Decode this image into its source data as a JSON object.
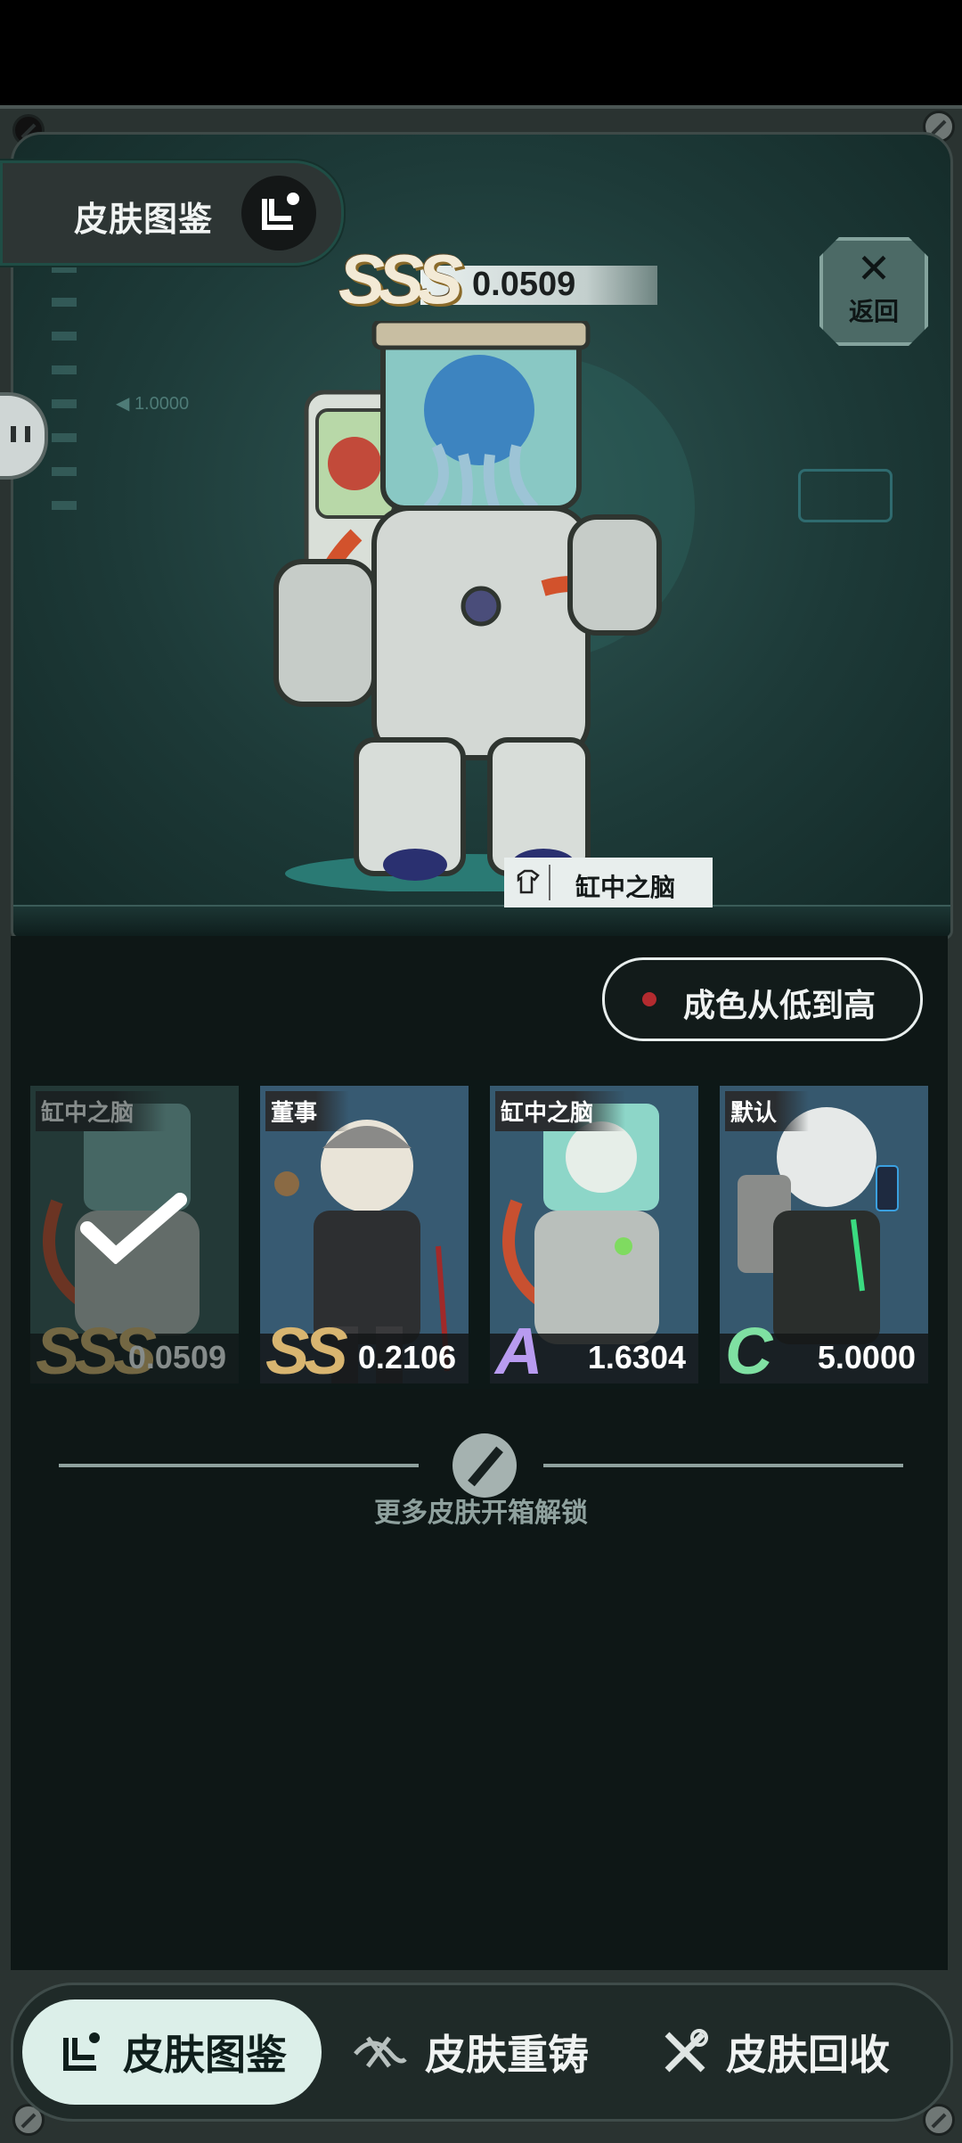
{
  "header": {
    "tab_title": "皮肤图鉴",
    "back_label": "返回",
    "back_icon": "close-x-icon",
    "grade": "SSS",
    "grade_value": "0.0509",
    "ruler_label": "1.0000"
  },
  "preview": {
    "skin_name": "缸中之脑",
    "skin_icon": "shirt-icon"
  },
  "sort": {
    "label": "成色从低到高",
    "dot_color": "#b32b2f"
  },
  "skins": [
    {
      "name": "缸中之脑",
      "grade": "SSS",
      "value": "0.0509",
      "selected": true,
      "grade_color": "#d8b570"
    },
    {
      "name": "董事",
      "grade": "SS",
      "value": "0.2106",
      "selected": false,
      "grade_color": "#d8b570"
    },
    {
      "name": "缸中之脑",
      "grade": "A",
      "value": "1.6304",
      "selected": false,
      "grade_color": "#b89bf0"
    },
    {
      "name": "默认",
      "grade": "C",
      "value": "5.0000",
      "selected": false,
      "grade_color": "#7fe0a2"
    }
  ],
  "unlock_hint": "更多皮肤开箱解锁",
  "bottom_nav": [
    {
      "label": "皮肤图鉴",
      "icon": "gallery-icon",
      "active": true
    },
    {
      "label": "皮肤重铸",
      "icon": "recast-icon",
      "active": false
    },
    {
      "label": "皮肤回收",
      "icon": "tools-icon",
      "active": false
    }
  ]
}
